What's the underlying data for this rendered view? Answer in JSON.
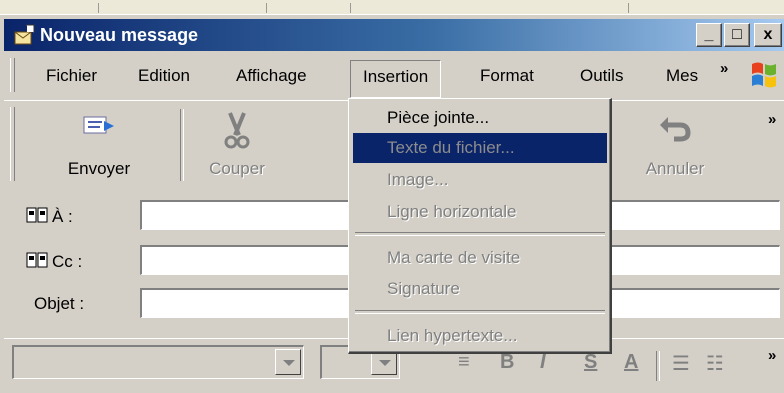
{
  "window": {
    "title": "Nouveau message",
    "buttons": {
      "minimize": "_",
      "maximize": "□",
      "close": "x"
    }
  },
  "menubar": {
    "items": [
      {
        "label": "Fichier"
      },
      {
        "label": "Edition"
      },
      {
        "label": "Affichage"
      },
      {
        "label": "Insertion"
      },
      {
        "label": "Format"
      },
      {
        "label": "Outils"
      },
      {
        "label": "Mes"
      }
    ],
    "overflow": "»",
    "open_menu": "Insertion"
  },
  "toolbar": {
    "buttons": [
      {
        "label": "Envoyer",
        "icon": "send-icon",
        "enabled": true
      },
      {
        "label": "Couper",
        "icon": "scissors-icon",
        "enabled": false
      },
      {
        "label": "Annuler",
        "icon": "undo-icon",
        "enabled": false
      }
    ],
    "overflow": "»"
  },
  "fields": {
    "to_label": "À :",
    "cc_label": "Cc :",
    "subject_label": "Objet :"
  },
  "insert_menu": {
    "items": [
      {
        "label": "Pièce jointe...",
        "enabled": true,
        "selected": false
      },
      {
        "label": "Texte du fichier...",
        "enabled": false,
        "selected": true
      },
      {
        "label": "Image...",
        "enabled": false,
        "selected": false
      },
      {
        "label": "Ligne horizontale",
        "enabled": false,
        "selected": false
      },
      {
        "label": "Ma carte de visite",
        "enabled": false,
        "selected": false
      },
      {
        "label": "Signature",
        "enabled": false,
        "selected": false
      },
      {
        "label": "Lien hypertexte...",
        "enabled": false,
        "selected": false
      }
    ]
  },
  "format_toolbar": {
    "overflow": "»"
  },
  "colors": {
    "title_start": "#0a246a",
    "title_end": "#a6caf0",
    "selection": "#0a246a",
    "face": "#d4d0c8"
  }
}
